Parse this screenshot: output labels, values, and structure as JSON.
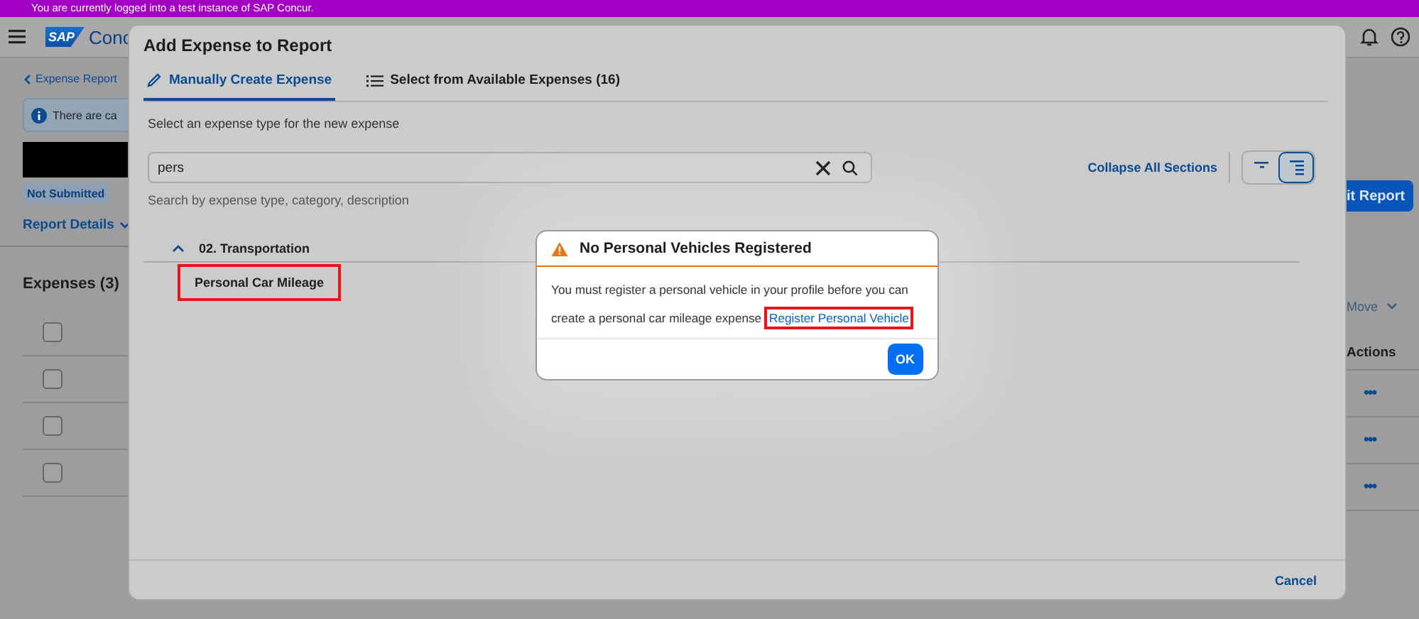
{
  "banner": {
    "text": "You are currently logged into a test instance of SAP Concur."
  },
  "header": {
    "logo": "SAP",
    "app_name": "Conc"
  },
  "page": {
    "back_link": "Expense Report",
    "info_text": "There are ca",
    "status_badge": "Not Submitted",
    "report_details": "Report Details",
    "submit_button": "it Report",
    "expenses_title": "Expenses (3)",
    "move_button": "Move",
    "actions_header": "Actions",
    "select_all": {
      "checked": false
    },
    "rows": [
      {
        "checked": false,
        "actions": "•••"
      },
      {
        "checked": false,
        "actions": "•••"
      },
      {
        "checked": false,
        "actions": "•••"
      }
    ]
  },
  "modal": {
    "title": "Add Expense to Report",
    "tabs": [
      {
        "label": "Manually Create Expense",
        "selected": true,
        "kind": "pencil"
      },
      {
        "label": "Select from Available Expenses (16)",
        "selected": false,
        "kind": "list"
      }
    ],
    "instruction": "Select an expense type for the new expense",
    "search": {
      "value": "pers",
      "hint": "Search by expense type, category, description"
    },
    "collapse_link": "Collapse All Sections",
    "view_toggle": [
      {
        "selected": false
      },
      {
        "selected": true
      }
    ],
    "sections": [
      {
        "title": "02. Transportation",
        "expanded": true,
        "items": [
          {
            "label": "Personal Car Mileage",
            "highlighted": true
          }
        ]
      }
    ],
    "cancel": "Cancel"
  },
  "alert": {
    "title": "No Personal Vehicles Registered",
    "message": "You must register a personal vehicle in your profile before you can create a personal car mileage expense",
    "link": "Register Personal Vehicle",
    "link_highlighted": true,
    "ok": "OK"
  }
}
